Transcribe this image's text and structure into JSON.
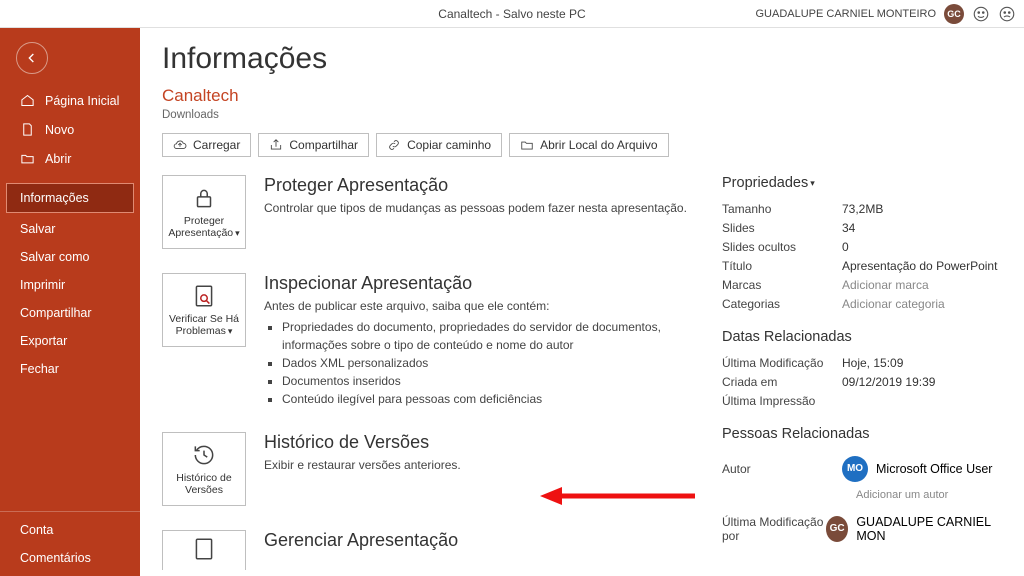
{
  "titlebar": {
    "doc": "Canaltech  -  Salvo neste PC",
    "user": "GUADALUPE CARNIEL MONTEIRO",
    "avatar": "GC"
  },
  "sidebar": {
    "home": "Página Inicial",
    "new": "Novo",
    "open": "Abrir",
    "info": "Informações",
    "save": "Salvar",
    "saveas": "Salvar como",
    "print": "Imprimir",
    "share": "Compartilhar",
    "export": "Exportar",
    "close": "Fechar",
    "account": "Conta",
    "feedback": "Comentários"
  },
  "page": {
    "title": "Informações",
    "docname": "Canaltech",
    "docpath": "Downloads"
  },
  "btns": {
    "upload": "Carregar",
    "share": "Compartilhar",
    "copy": "Copiar caminho",
    "openloc": "Abrir Local do Arquivo"
  },
  "sections": {
    "protect": {
      "tile": "Proteger Apresentação",
      "title": "Proteger Apresentação",
      "desc": "Controlar que tipos de mudanças as pessoas podem fazer nesta apresentação."
    },
    "inspect": {
      "tile": "Verificar Se Há Problemas",
      "title": "Inspecionar Apresentação",
      "lead": "Antes de publicar este arquivo, saiba que ele contém:",
      "b1": "Propriedades do documento, propriedades do servidor de documentos, informações sobre o tipo de conteúdo e nome do autor",
      "b2": "Dados XML personalizados",
      "b3": "Documentos inseridos",
      "b4": "Conteúdo ilegível para pessoas com deficiências"
    },
    "history": {
      "tile": "Histórico de Versões",
      "title": "Histórico de Versões",
      "desc": "Exibir e restaurar versões anteriores."
    },
    "manage": {
      "tile": "",
      "title": "Gerenciar Apresentação"
    }
  },
  "props": {
    "header": "Propriedades",
    "size_k": "Tamanho",
    "size_v": "73,2MB",
    "slides_k": "Slides",
    "slides_v": "34",
    "hidden_k": "Slides ocultos",
    "hidden_v": "0",
    "title_k": "Título",
    "title_v": "Apresentação do PowerPoint",
    "tags_k": "Marcas",
    "tags_v": "Adicionar marca",
    "cat_k": "Categorias",
    "cat_v": "Adicionar categoria",
    "dates_h": "Datas Relacionadas",
    "mod_k": "Última Modificação",
    "mod_v": "Hoje, 15:09",
    "created_k": "Criada em",
    "created_v": "09/12/2019 19:39",
    "printed_k": "Última Impressão",
    "printed_v": "",
    "people_h": "Pessoas Relacionadas",
    "author_k": "Autor",
    "author_av": "MO",
    "author_name": "Microsoft Office User",
    "add_author": "Adicionar um autor",
    "modby_k": "Última Modificação por",
    "modby_av": "GC",
    "modby_name": "GUADALUPE CARNIEL MON"
  }
}
